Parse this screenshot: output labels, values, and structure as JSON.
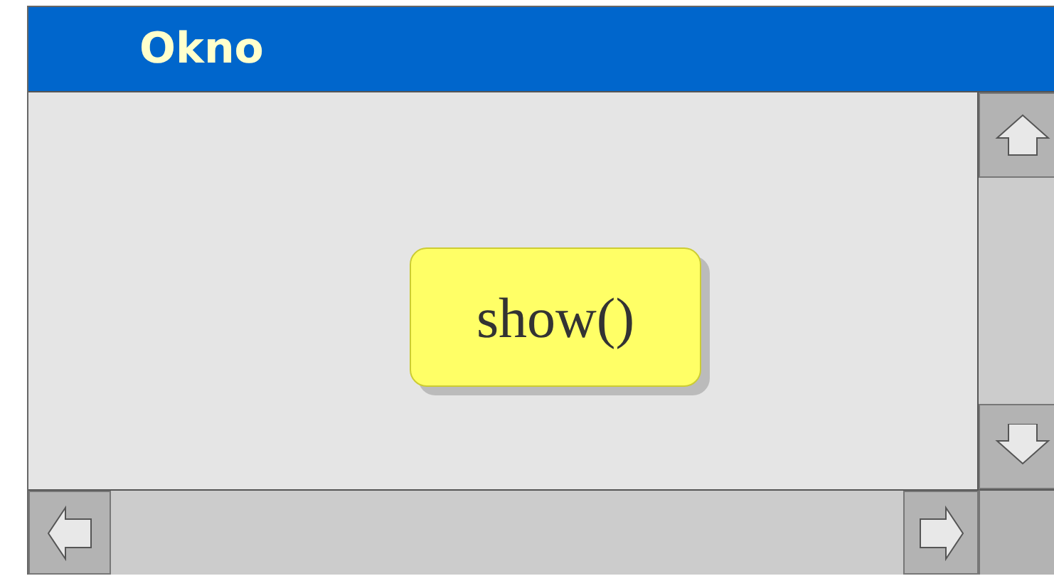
{
  "window": {
    "title": "Okno"
  },
  "content": {
    "button": {
      "label": "show()"
    }
  }
}
